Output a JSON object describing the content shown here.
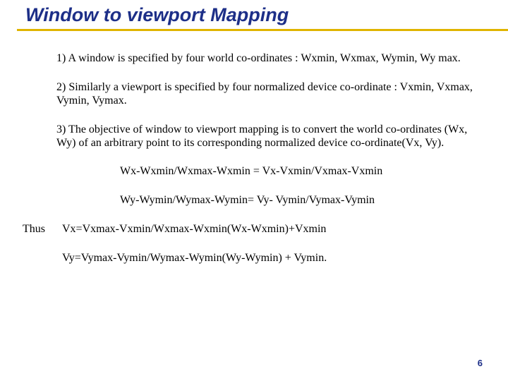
{
  "slide": {
    "title": "Window to viewport Mapping",
    "points": {
      "p1": "1) A window is specified by four world co-ordinates : Wxmin, Wxmax, Wymin, Wy max.",
      "p2": "2) Similarly a viewport is specified by four normalized device co-ordinate : Vxmin, Vxmax, Vymin, Vymax.",
      "p3": "3) The objective of window to viewport mapping is to convert the world co-ordinates (Wx, Wy) of an arbitrary point to its corresponding normalized device co-ordinate(Vx, Vy)."
    },
    "equations": {
      "eq1": "Wx-Wxmin/Wxmax-Wxmin = Vx-Vxmin/Vxmax-Vxmin",
      "eq2": "Wy-Wymin/Wymax-Wymin= Vy- Vymin/Vymax-Vymin",
      "thus_label": "Thus",
      "eq3": "Vx=Vxmax-Vxmin/Wxmax-Wxmin(Wx-Wxmin)+Vxmin",
      "eq4": "Vy=Vymax-Vymin/Wymax-Wymin(Wy-Wymin) + Vymin."
    },
    "page_number": "6"
  }
}
